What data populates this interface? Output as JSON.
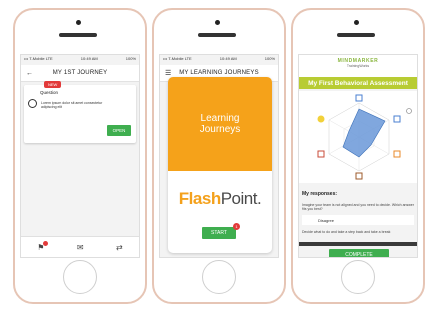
{
  "phone1": {
    "status": {
      "left": "••• T-Mobile LTE",
      "center": "10:49 AM",
      "right": "100%"
    },
    "nav_title": "MY 1ST JOURNEY",
    "back_icon": "back-arrow",
    "card": {
      "badge": "NEW",
      "label": "Question",
      "text": "Lorem ipsum dolor sit amet consectetur adipiscing elit",
      "button": "OPEN"
    },
    "bottom_icons": [
      "flag-icon",
      "mail-icon",
      "share-icon"
    ]
  },
  "phone2": {
    "status": {
      "left": "••• T-Mobile LTE",
      "center": "10:49 AM",
      "right": "100%"
    },
    "nav_title": "MY LEARNING JOURNEYS",
    "menu_icon": "hamburger",
    "card": {
      "title_line1": "Learning",
      "title_line2": "Journeys",
      "brand_part1": "Flash",
      "brand_part2": "Point",
      "brand_dot": ".",
      "button": "START",
      "badge_count": "1"
    }
  },
  "phone3": {
    "brand": "MINDMARKER",
    "brand_sub": "TrainingWorks",
    "assessment_title": "My First Behavioral Assessment",
    "responses_title": "My responses:",
    "q1": "Imagine your team is not aligned and you need to decide. Which answer fits you best?",
    "q1_answer": "Disagree",
    "q2": "Decide what to do and take a step back and take a break",
    "complete_button": "COMPLETE",
    "accent_color": "#b8cc33",
    "button_color": "#3fae4f"
  }
}
